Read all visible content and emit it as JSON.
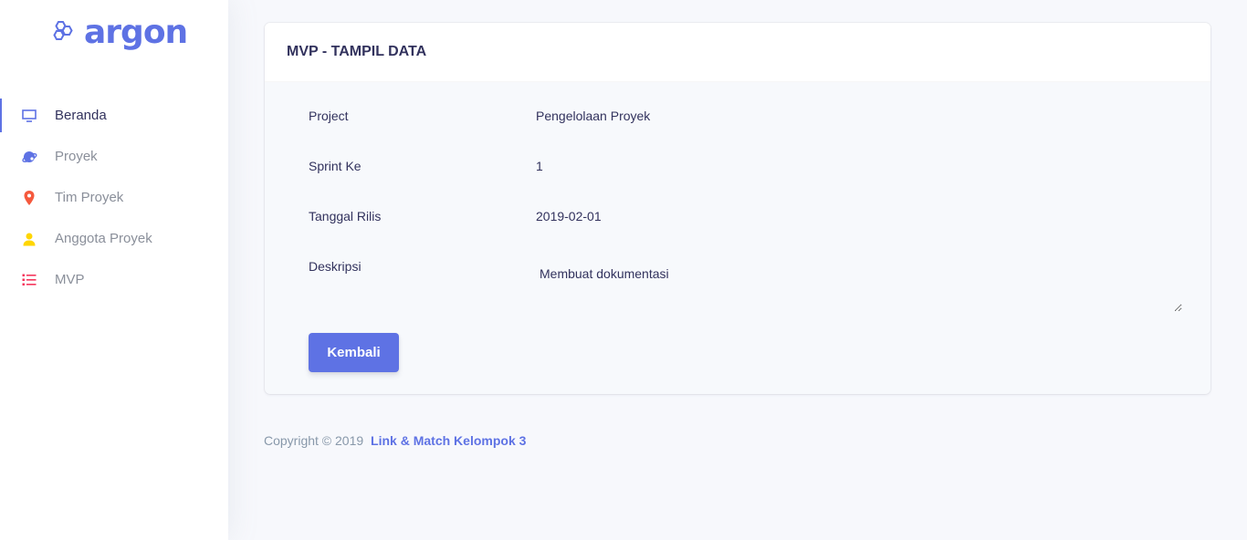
{
  "brand": {
    "name": "argon",
    "icon": "hexagons-logo-icon",
    "color": "#5e72e4"
  },
  "sidebar": {
    "items": [
      {
        "label": "Beranda",
        "icon": "monitor-icon",
        "color": "#5e72e4",
        "active": true
      },
      {
        "label": "Proyek",
        "icon": "planet-icon",
        "color": "#5e72e4",
        "active": false
      },
      {
        "label": "Tim Proyek",
        "icon": "pin-icon",
        "color": "#f5593d",
        "active": false
      },
      {
        "label": "Anggota Proyek",
        "icon": "user-icon",
        "color": "#ffd600",
        "active": false
      },
      {
        "label": "MVP",
        "icon": "list-icon",
        "color": "#f5365c",
        "active": false
      }
    ]
  },
  "card": {
    "title": "MVP - TAMPIL DATA",
    "fields": [
      {
        "label": "Project",
        "value": "Pengelolaan Proyek"
      },
      {
        "label": "Sprint Ke",
        "value": "1"
      },
      {
        "label": "Tanggal Rilis",
        "value": "2019-02-01"
      },
      {
        "label": "Deskripsi",
        "value": "Membuat dokumentasi"
      }
    ],
    "back_button": "Kembali"
  },
  "footer": {
    "copyright": "Copyright © 2019",
    "link": "Link & Match Kelompok 3"
  }
}
